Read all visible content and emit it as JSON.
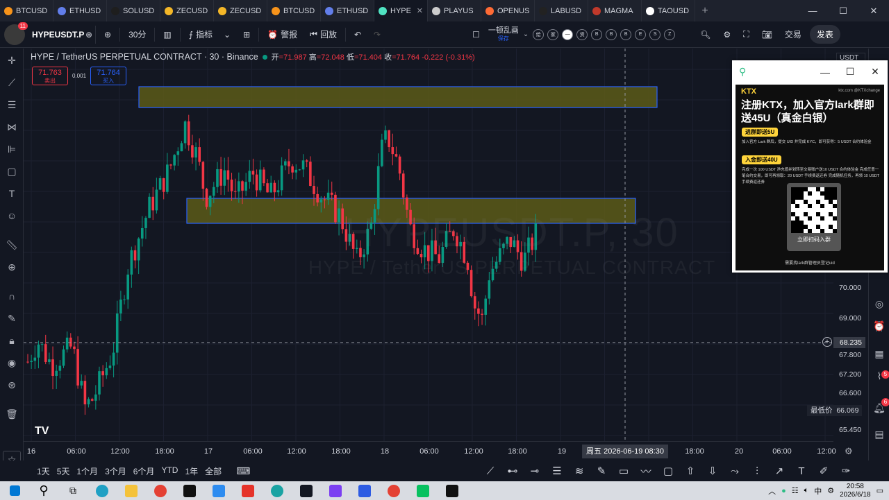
{
  "browser": {
    "tabs": [
      {
        "label": "BTCUSD",
        "color": "#f7931a"
      },
      {
        "label": "ETHUSD",
        "color": "#627eea"
      },
      {
        "label": "SOLUSD",
        "color": "#1e1e1e"
      },
      {
        "label": "ZECUSD",
        "color": "#f4b728"
      },
      {
        "label": "ZECUSD",
        "color": "#f4b728"
      },
      {
        "label": "BTCUSD",
        "color": "#f7931a"
      },
      {
        "label": "ETHUSD",
        "color": "#627eea"
      },
      {
        "label": "HYPE",
        "color": "#50e3c2",
        "active": true
      },
      {
        "label": "PLAYUS",
        "color": "#cccccc"
      },
      {
        "label": "OPENUS",
        "color": "#ff6b35"
      },
      {
        "label": "LABUSD",
        "color": "#222222"
      },
      {
        "label": "MAGMA",
        "color": "#c0392b"
      },
      {
        "label": "TAOUSD",
        "color": "#ffffff"
      }
    ],
    "new_tab": "+",
    "controls": {
      "minimize": "—",
      "maximize": "☐",
      "close": "✕"
    }
  },
  "toolbar": {
    "avatar_badge": "11",
    "symbol": "HYPEUSDT.P",
    "interval": "30分",
    "indicators": "指标",
    "alerts": "警报",
    "replay": "回放",
    "save_title": "一顿乱画",
    "save_sub": "保存",
    "circle_buttons": [
      "绘",
      "家",
      "—",
      "资",
      "B",
      "B",
      "B",
      "E",
      "S",
      "Z"
    ],
    "trade": "交易",
    "publish": "发表"
  },
  "legend": {
    "title": "HYPE / TetherUS PERPETUAL CONTRACT · 30 · Binance",
    "open_label": "开",
    "open": "=71.987",
    "high_label": "高",
    "high": "=72.048",
    "low_label": "低",
    "low": "=71.404",
    "close_label": "收",
    "close": "=71.764",
    "change": "-0.222 (-0.31%)"
  },
  "price_buttons": {
    "sell_price": "71.763",
    "sell_label": "卖出",
    "spread": "0.001",
    "buy_price": "71.764",
    "buy_label": "买入"
  },
  "watermark": {
    "symbol": "HYPEUSDT.P, 30",
    "name": "HYPE / TetherUS PERPETUAL CONTRACT"
  },
  "price_axis": {
    "currency": "USDT ▾",
    "ticks": [
      "70.000",
      "69.000",
      "67.800",
      "67.200",
      "66.600",
      "65.450"
    ],
    "crosshair_price": "68.235",
    "low_label": "最低价",
    "low_price": "66.069"
  },
  "time_axis": {
    "ticks": [
      "16",
      "06:00",
      "12:00",
      "18:00",
      "17",
      "06:00",
      "12:00",
      "18:00",
      "18",
      "06:00",
      "12:00",
      "18:00",
      "19",
      "18:00",
      "20",
      "06:00",
      "12:00"
    ],
    "crosshair": "周五 2026-06-19   08:30"
  },
  "periods": [
    "1天",
    "5天",
    "1个月",
    "3个月",
    "6个月",
    "YTD",
    "1年",
    "全部"
  ],
  "chart_data": {
    "type": "candlestick",
    "pair": "HYPE / TetherUS PERPETUAL CONTRACT",
    "interval": "30",
    "exchange": "Binance",
    "last": {
      "open": 71.987,
      "high": 72.048,
      "low": 71.404,
      "close": 71.764
    },
    "zones": [
      {
        "name": "upper-zone",
        "color": "#5c5a18"
      },
      {
        "name": "middle-zone",
        "color": "#5c5a18"
      }
    ],
    "colors": {
      "up": "#089981",
      "down": "#f23645"
    }
  },
  "popup": {
    "logo": "KTX",
    "handle": "ktx.com   @KTXchange",
    "headline": "注册KTX，加入官方lark群即送45U（真金白银）",
    "pill1": "进群即送5U",
    "text1": "加入官方 Lark 群后，提交 UID 并完成 KYC，即可获得：5 USDT 合约体验金",
    "pill2": "入金即送40U",
    "text2": "完成一次 100 USDT 净充值并划转至交易账户送10 USDT 合约体验金 完成任意一笔合约交易，即可再领取：20 USDT 手续费返还券 完成随机任务，再领 10 USDT 手续费返还券",
    "qr_caption": "立即扫码入群",
    "footer": "需要找lark群管理员登记uid"
  },
  "taskbar": {
    "time": "20:58",
    "date": "2026/6/18",
    "ime": "中"
  }
}
